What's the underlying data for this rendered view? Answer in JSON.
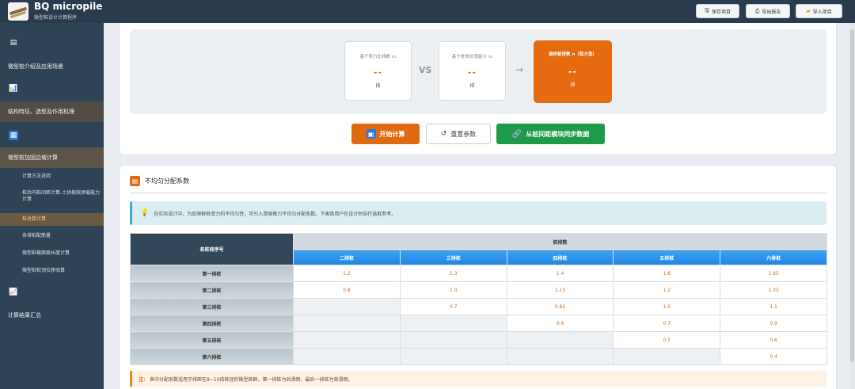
{
  "header": {
    "title": "BQ micropile",
    "subtitle": "微型桩设计计算程序",
    "buttons": [
      {
        "label": "保存项目",
        "icon": "save-icon"
      },
      {
        "label": "导出报告",
        "icon": "export-icon"
      },
      {
        "label": "导入项目",
        "icon": "folder-icon"
      }
    ]
  },
  "sidebar": {
    "sections": [
      {
        "label": "微型桩介绍及应用场景",
        "icon": "book-icon"
      },
      {
        "label": "结构特征、选型及作用机理",
        "icon": "chart-icon"
      },
      {
        "label": "微型桩加固边坡计算",
        "icon": "grid-icon"
      },
      {
        "label": "计算结果汇总",
        "icon": "bar-chart-icon"
      }
    ],
    "sub_items": [
      "计算方法说明",
      "桩后内桩间距计算-土拱极限承载能力计算",
      "桩总数计算",
      "各排桩配筋量",
      "微型桩截面极长度计算",
      "微型桩桩顶位移验算"
    ]
  },
  "results": {
    "left_label": "基于剪力比排数 n₁",
    "left_value": "--",
    "left_unit": "排",
    "vs": "VS",
    "middle_label": "基于桩体抗弯能力 n₂",
    "middle_value": "--",
    "middle_unit": "排",
    "arrow": "→",
    "final_label": "最终桩排数 n（取大值）",
    "final_value": "--",
    "final_unit": "排"
  },
  "actions": {
    "calc": "开始计算",
    "reset": "重置参数",
    "sync": "从桩间距模块同步数据"
  },
  "section": {
    "title": "不均匀分配系数",
    "info": "在实际设计中，为反映群桩受力的不均匀性，可引入滑坡推力不均匀分配系数。下表供用户在设计时自行选取参考。"
  },
  "table": {
    "row_header": "各桩排序号",
    "group_header": "桩排数",
    "columns": [
      "二排桩",
      "三排桩",
      "四排桩",
      "五排桩",
      "六排桩"
    ],
    "rows": [
      {
        "label": "第一排桩",
        "values": [
          "1.2",
          "1.3",
          "1.4",
          "1.6",
          "1.65"
        ]
      },
      {
        "label": "第二排桩",
        "values": [
          "0.8",
          "1.0",
          "1.15",
          "1.2",
          "1.35"
        ]
      },
      {
        "label": "第三排桩",
        "values": [
          "",
          "0.7",
          "0.85",
          "1.0",
          "1.1"
        ]
      },
      {
        "label": "第四排桩",
        "values": [
          "",
          "",
          "0.6",
          "0.7",
          "0.9"
        ]
      },
      {
        "label": "第五排桩",
        "values": [
          "",
          "",
          "",
          "0.5",
          "0.6"
        ]
      },
      {
        "label": "第六排桩",
        "values": [
          "",
          "",
          "",
          "",
          "0.4"
        ]
      }
    ]
  },
  "note": {
    "prefix": "注：",
    "text": "表中分配系数适用于排距在8~10倍桩径的微型桩群，第一排桩为后滑侧，最后一排桩为背滑侧。"
  }
}
